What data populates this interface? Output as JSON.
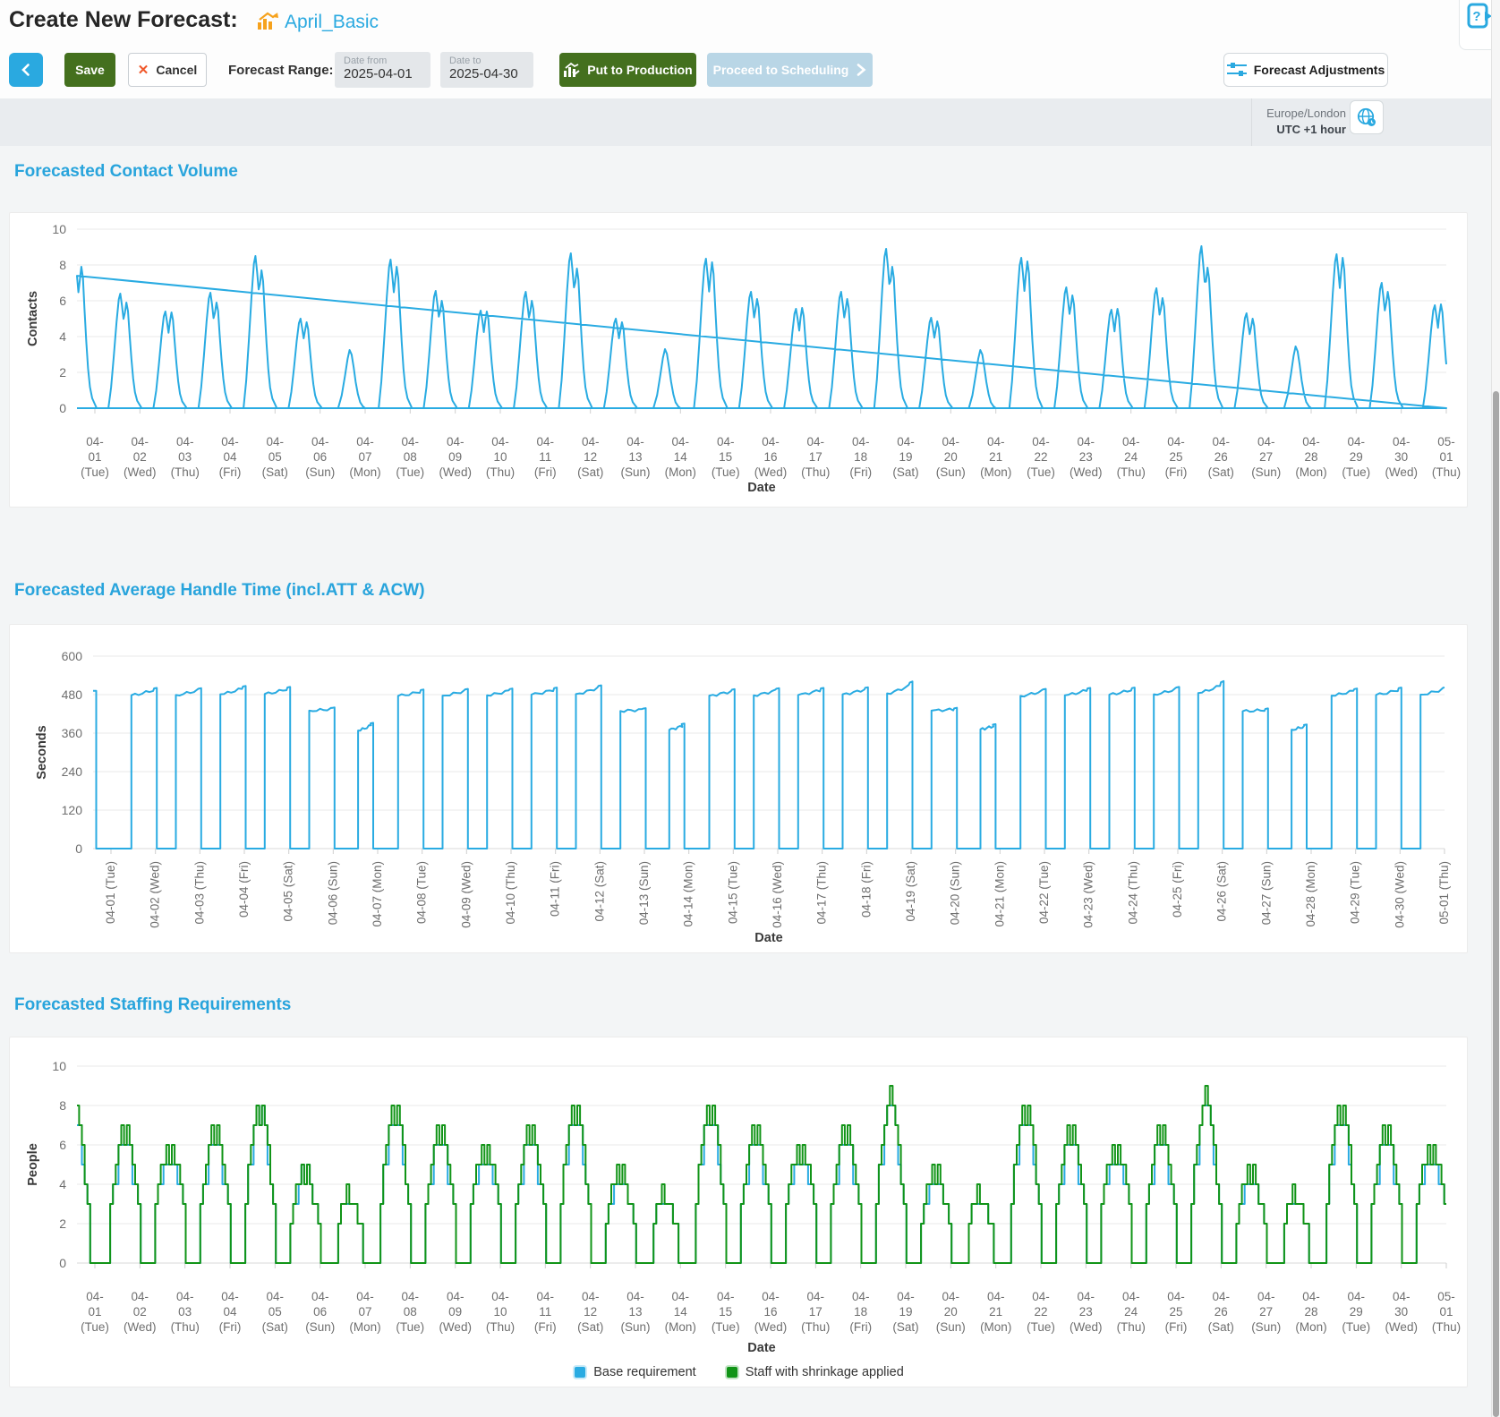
{
  "header": {
    "title": "Create New Forecast:",
    "forecast_name": "April_Basic"
  },
  "toolbar": {
    "save": "Save",
    "cancel": "Cancel",
    "cancel_icon": "✕",
    "range_label": "Forecast Range:",
    "date_from": {
      "label": "Date from",
      "value": "2025-04-01"
    },
    "date_to": {
      "label": "Date to",
      "value": "2025-04-30"
    },
    "put_to_production": "Put to Production",
    "proceed_to_scheduling": "Proceed to Scheduling",
    "forecast_adjustments": "Forecast Adjustments"
  },
  "timezone": {
    "region": "Europe/London",
    "offset": "UTC +1 hour"
  },
  "colors": {
    "accent_blue": "#29abe2",
    "title_blue": "#28a4dc",
    "button_green": "#44701e",
    "disabled_button_blue": "#b9d6e6",
    "cancel_x_orange": "#f0582b",
    "header_icon_orange": "#f6a21d",
    "series_blue": "#29abe2",
    "series_green": "#119417"
  },
  "dates": [
    {
      "d": "04-01",
      "w": "(Tue)"
    },
    {
      "d": "04-02",
      "w": "(Wed)"
    },
    {
      "d": "04-03",
      "w": "(Thu)"
    },
    {
      "d": "04-04",
      "w": "(Fri)"
    },
    {
      "d": "04-05",
      "w": "(Sat)"
    },
    {
      "d": "04-06",
      "w": "(Sun)"
    },
    {
      "d": "04-07",
      "w": "(Mon)"
    },
    {
      "d": "04-08",
      "w": "(Tue)"
    },
    {
      "d": "04-09",
      "w": "(Wed)"
    },
    {
      "d": "04-10",
      "w": "(Thu)"
    },
    {
      "d": "04-11",
      "w": "(Fri)"
    },
    {
      "d": "04-12",
      "w": "(Sat)"
    },
    {
      "d": "04-13",
      "w": "(Sun)"
    },
    {
      "d": "04-14",
      "w": "(Mon)"
    },
    {
      "d": "04-15",
      "w": "(Tue)"
    },
    {
      "d": "04-16",
      "w": "(Wed)"
    },
    {
      "d": "04-17",
      "w": "(Thu)"
    },
    {
      "d": "04-18",
      "w": "(Fri)"
    },
    {
      "d": "04-19",
      "w": "(Sat)"
    },
    {
      "d": "04-20",
      "w": "(Sun)"
    },
    {
      "d": "04-21",
      "w": "(Mon)"
    },
    {
      "d": "04-22",
      "w": "(Tue)"
    },
    {
      "d": "04-23",
      "w": "(Wed)"
    },
    {
      "d": "04-24",
      "w": "(Thu)"
    },
    {
      "d": "04-25",
      "w": "(Fri)"
    },
    {
      "d": "04-26",
      "w": "(Sat)"
    },
    {
      "d": "04-27",
      "w": "(Sun)"
    },
    {
      "d": "04-28",
      "w": "(Mon)"
    },
    {
      "d": "04-29",
      "w": "(Tue)"
    },
    {
      "d": "04-30",
      "w": "(Wed)"
    },
    {
      "d": "05-01",
      "w": "(Thu)"
    }
  ],
  "chart_data": [
    {
      "type": "line",
      "title": "Forecasted Contact Volume",
      "xlabel": "Date",
      "ylabel": "Contacts",
      "ylim": [
        0,
        10
      ],
      "yticks": [
        0,
        2,
        4,
        6,
        8,
        10
      ],
      "series_color": "#29abe2",
      "description": "Intraday contact volume per day: zero overnight, double-peaked hump in the afternoon/evening. Values below are the two daily peak heights (single peak on Sundays).",
      "daily_peaks": [
        [
          6.4,
          5.9
        ],
        [
          5.4,
          5.35
        ],
        [
          6.45,
          5.9
        ],
        [
          8.5,
          7.7
        ],
        [
          5.0,
          4.8
        ],
        [
          3.25,
          null
        ],
        [
          8.3,
          7.9
        ],
        [
          6.55,
          6.0
        ],
        [
          5.45,
          5.4
        ],
        [
          6.5,
          6.0
        ],
        [
          8.65,
          7.8
        ],
        [
          5.0,
          4.8
        ],
        [
          3.3,
          null
        ],
        [
          8.35,
          8.15
        ],
        [
          6.5,
          6.1
        ],
        [
          5.55,
          5.6
        ],
        [
          6.5,
          6.1
        ],
        [
          8.9,
          7.9
        ],
        [
          5.05,
          4.85
        ],
        [
          3.25,
          null
        ],
        [
          8.4,
          8.2
        ],
        [
          6.75,
          6.3
        ],
        [
          5.5,
          5.55
        ],
        [
          6.7,
          6.15
        ],
        [
          9.05,
          7.85
        ],
        [
          5.3,
          5.0
        ],
        [
          3.45,
          null
        ],
        [
          8.6,
          8.4
        ],
        [
          7.0,
          6.5
        ],
        [
          5.75,
          5.8
        ]
      ],
      "prev_day_peaks": [
        8.3,
        7.9
      ],
      "edge_start_value": 3.0,
      "edge_end_value": 2.4
    },
    {
      "type": "line",
      "title": "Forecasted Average Handle Time (incl.ATT & ACW)",
      "xlabel": "Date",
      "ylabel": "Seconds",
      "ylim": [
        0,
        600
      ],
      "yticks": [
        0,
        120,
        240,
        360,
        480,
        600
      ],
      "series_color": "#29abe2",
      "description": "Daily AHT plateau during operating hours, zero overnight. Values are [start,end] seconds of each day's plateau; Saturdays ~430s, Sundays ~375s with a shorter window, Fridays end with a spike ~513s.",
      "daily_plateau_sec": [
        [
          478,
          497
        ],
        [
          479,
          496
        ],
        [
          481,
          503
        ],
        [
          482,
          500
        ],
        [
          430,
          436
        ],
        [
          368,
          388
        ],
        [
          476,
          492
        ],
        [
          477,
          494
        ],
        [
          478,
          495
        ],
        [
          480,
          498
        ],
        [
          482,
          505
        ],
        [
          429,
          434
        ],
        [
          370,
          386
        ],
        [
          477,
          493
        ],
        [
          478,
          496
        ],
        [
          479,
          497
        ],
        [
          481,
          499
        ],
        [
          484,
          512
        ],
        [
          430,
          435
        ],
        [
          372,
          384
        ],
        [
          476,
          494
        ],
        [
          478,
          497
        ],
        [
          480,
          498
        ],
        [
          481,
          500
        ],
        [
          485,
          513
        ],
        [
          428,
          433
        ],
        [
          371,
          383
        ],
        [
          477,
          495
        ],
        [
          479,
          498
        ],
        [
          480,
          499
        ]
      ],
      "prev_day_plateau_sec": [
        476,
        492
      ]
    },
    {
      "type": "step",
      "title": "Forecasted Staffing Requirements",
      "xlabel": "Date",
      "ylabel": "People",
      "ylim": [
        0,
        10
      ],
      "yticks": [
        0,
        2,
        4,
        6,
        8,
        10
      ],
      "description": "Stepped staffing levels per day; values are each day's peak headcount.",
      "series": [
        {
          "name": "Base requirement",
          "color": "#29abe2",
          "daily_peak": [
            6,
            5,
            6,
            8,
            5,
            3,
            7,
            6,
            5,
            6,
            7,
            4,
            3,
            7,
            6,
            5,
            6,
            8,
            4,
            3,
            7,
            6,
            5,
            6,
            8,
            4,
            3,
            7,
            6,
            5
          ]
        },
        {
          "name": "Staff with shrinkage applied",
          "color": "#119417",
          "daily_peak": [
            7,
            6,
            7,
            8,
            5,
            4,
            8,
            7,
            6,
            7,
            8,
            5,
            4,
            8,
            7,
            6,
            7,
            9,
            5,
            4,
            8,
            7,
            6,
            7,
            9,
            5,
            4,
            8,
            7,
            6
          ]
        }
      ],
      "prev_day_peak": {
        "base": 7,
        "with_shrinkage": 8
      },
      "legend_position": "bottom"
    }
  ]
}
